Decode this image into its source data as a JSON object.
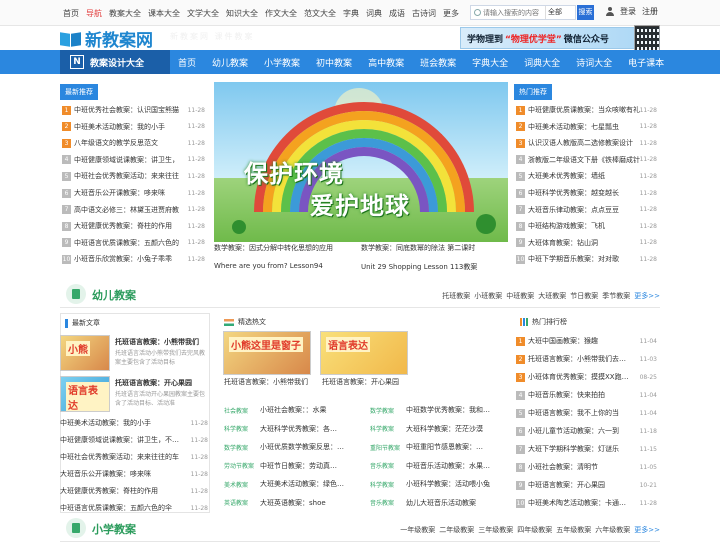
{
  "topnav": {
    "items": [
      "首页",
      "导航",
      "教案大全",
      "课本大全",
      "文学大全",
      "知识大全",
      "作文大全",
      "范文大全",
      "字典",
      "词典",
      "成语",
      "古诗词",
      "更多"
    ]
  },
  "search": {
    "placeholder": "请输入搜索的内容",
    "select": "全部",
    "button": "搜索"
  },
  "auth": {
    "login": "登录",
    "register": "注册"
  },
  "logo": {
    "name": "新教案网",
    "slogan": "新教案网 课件教案"
  },
  "banner": {
    "pre": "学物理到",
    "highlight": "“物理优学堂”",
    "post": "微信公众号"
  },
  "nav": {
    "first": "教案设计大全",
    "items": [
      "首页",
      "幼儿教案",
      "小学教案",
      "初中教案",
      "高中教案",
      "班会教案",
      "字典大全",
      "词典大全",
      "诗词大全",
      "电子课本"
    ]
  },
  "latest": {
    "title": "最新推荐",
    "items": [
      {
        "n": "1",
        "t": "中班优秀社会教案：认识国宝熊猫",
        "d": "11-28"
      },
      {
        "n": "2",
        "t": "中班美术活动教案：我的小手",
        "d": "11-28"
      },
      {
        "n": "3",
        "t": "八年级语文的教学反思范文",
        "d": "11-28"
      },
      {
        "n": "4",
        "t": "中班健康领域说课教案：讲卫生，",
        "d": "11-28"
      },
      {
        "n": "5",
        "t": "中班社会优秀教案活动：来来往往",
        "d": "11-28"
      },
      {
        "n": "6",
        "t": "大班音乐公开课教案：哆来咪",
        "d": "11-28"
      },
      {
        "n": "7",
        "t": "高中语文必修三：林黛玉进贾府教",
        "d": "11-28"
      },
      {
        "n": "8",
        "t": "大班健康优秀教案：脊柱的作用",
        "d": "11-28"
      },
      {
        "n": "9",
        "t": "中班语言优质课教案：五颜六色的",
        "d": "11-28"
      },
      {
        "n": "10",
        "t": "小班音乐欣赏教案：小兔子乖乖",
        "d": "11-28"
      }
    ]
  },
  "hero": {
    "line1": "保护环境",
    "line2": "爱护地球"
  },
  "centerlinks": [
    [
      "数学教案：因式分解中转化思想的应用",
      "数学教案：同底数幂的除法 第二课时"
    ],
    [
      "Where are you from? Lesson94",
      "Unit 29 Shopping Lesson 113教案"
    ]
  ],
  "hot": {
    "title": "热门推荐",
    "items": [
      {
        "n": "1",
        "t": "中班健康优质课教案：当众咳嗽有礼",
        "d": "11-28"
      },
      {
        "n": "2",
        "t": "中班美术活动教案：七星瓢虫",
        "d": "11-28"
      },
      {
        "n": "3",
        "t": "认识汉语人教版高二选修教案设计",
        "d": "11-28"
      },
      {
        "n": "4",
        "t": "浙教版二年级语文下册《铁棒磨成针",
        "d": "11-28"
      },
      {
        "n": "5",
        "t": "大班美术优秀教案：墙纸",
        "d": "11-28"
      },
      {
        "n": "6",
        "t": "中班科学优秀教案：越变越长",
        "d": "11-28"
      },
      {
        "n": "7",
        "t": "大班音乐律动教案：点点豆豆",
        "d": "11-28"
      },
      {
        "n": "8",
        "t": "中班结构游戏教案：飞机",
        "d": "11-28"
      },
      {
        "n": "9",
        "t": "大班体育教案：钻山洞",
        "d": "11-28"
      },
      {
        "n": "10",
        "t": "中班下学期音乐教案：对对歌",
        "d": "11-28"
      }
    ]
  },
  "kinder": {
    "title": "幼儿教案",
    "links": [
      "托班教案",
      "小班教案",
      "中班教案",
      "大班教案",
      "节日教案",
      "季节教案"
    ],
    "more": "更多>>",
    "latestTitle": "最新文章",
    "articles": [
      {
        "h": "托班语言教案：小熊带我们",
        "d": "托班语言活动小熊带我们去完风教案主要包含了活动目标"
      },
      {
        "h": "托班语言教案：开心果园",
        "d": "托班语言活动开心果园教案主要包含了活动目标、活动准"
      }
    ],
    "thumbcap1": "小熊",
    "thumbcap2": "语言表达",
    "lines": [
      {
        "t": "中班美术活动教案：我的小手",
        "d": "11-28"
      },
      {
        "t": "中班健康领域说课教案：讲卫生，不…",
        "d": "11-28"
      },
      {
        "t": "中班社会优秀教案活动：来来往往的车",
        "d": "11-28"
      },
      {
        "t": "大班音乐公开课教案：哆来咪",
        "d": "11-28"
      },
      {
        "t": "大班健康优秀教案：脊柱的作用",
        "d": "11-28"
      },
      {
        "t": "中班语言优质课教案：五颜六色的伞",
        "d": "11-28"
      }
    ],
    "featTitle": "精选热文",
    "feat": [
      "托班语言教案：小熊带我们",
      "托班语言教案：开心果园"
    ],
    "featcap1": "小熊这里是窗子",
    "featcap2": "语言表达",
    "grid": [
      [
        {
          "tag": "社会教案",
          "t": "小班社会教案：：水果"
        },
        {
          "tag": "数学教案",
          "t": "中班数学优秀教案：我和…"
        }
      ],
      [
        {
          "tag": "科学教案",
          "t": "大班科学优秀教案：各…"
        },
        {
          "tag": "科学教案",
          "t": "大班科学教案：茫茫沙漠"
        }
      ],
      [
        {
          "tag": "数学教案",
          "t": "小班优质数学教案反思：…"
        },
        {
          "tag": "重阳节教案",
          "t": "中班重阳节感恩教案：…"
        }
      ],
      [
        {
          "tag": "劳动节教案",
          "t": "中班节日教案：劳动真…"
        },
        {
          "tag": "音乐教案",
          "t": "中班音乐活动教案：水果…"
        }
      ],
      [
        {
          "tag": "美术教案",
          "t": "大班美术活动教案：绿色…"
        },
        {
          "tag": "科学教案",
          "t": "小班科学教案：活动喂小兔"
        }
      ],
      [
        {
          "tag": "英语教案",
          "t": "大班英语教案：shoe"
        },
        {
          "tag": "音乐教案",
          "t": "幼儿大班音乐活动教案"
        }
      ]
    ],
    "rankTitle": "热门排行榜",
    "rank": [
      {
        "n": "1",
        "t": "大班中国画教案：猴趣",
        "d": "11-04"
      },
      {
        "n": "2",
        "t": "托班语言教案：小熊带我们去…",
        "d": "11-03"
      },
      {
        "n": "3",
        "t": "小班体育优秀教案：摸摸XX跑…",
        "d": "08-25"
      },
      {
        "n": "4",
        "t": "中班音乐教案：快来拍拍",
        "d": "11-04"
      },
      {
        "n": "5",
        "t": "中班语言教案：我不上你的当",
        "d": "11-04"
      },
      {
        "n": "6",
        "t": "小班儿童节活动教案：六一到",
        "d": "11-18"
      },
      {
        "n": "7",
        "t": "大班下学期科学教案：灯谜乐",
        "d": "11-15"
      },
      {
        "n": "8",
        "t": "小班社会教案：清明节",
        "d": "11-05"
      },
      {
        "n": "9",
        "t": "中班语言教案：开心果园",
        "d": "10-21"
      },
      {
        "n": "10",
        "t": "中班美术陶艺活动教案：卡通…",
        "d": "11-28"
      }
    ]
  },
  "primary": {
    "title": "小学教案",
    "links": [
      "一年级教案",
      "二年级教案",
      "三年级教案",
      "四年级教案",
      "五年级教案",
      "六年级教案"
    ],
    "more": "更多>>"
  },
  "colors": {
    "accent": "#2b87df",
    "green": "#36a86a",
    "orange": "#f08c2a"
  }
}
